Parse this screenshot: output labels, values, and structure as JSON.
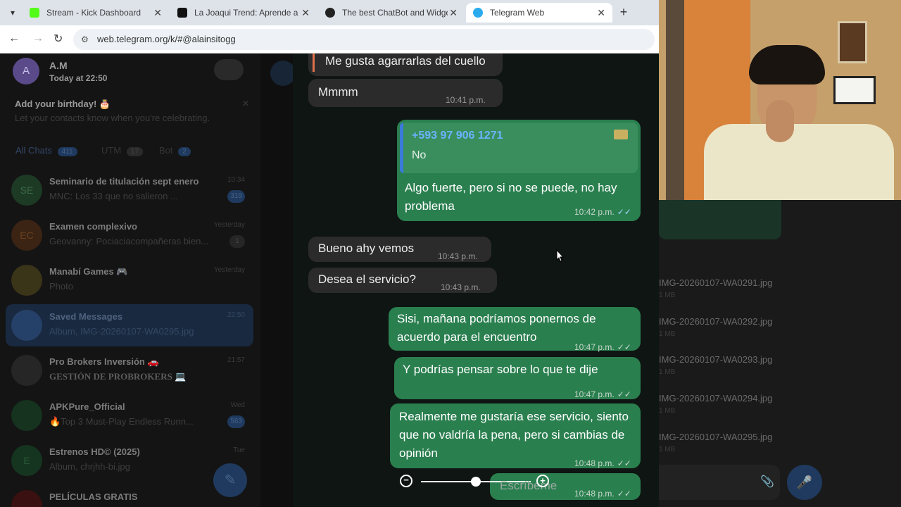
{
  "browser": {
    "tabs": [
      {
        "title": "Stream - Kick Dashboard",
        "favicon_color": "#53fc18"
      },
      {
        "title": "La Joaqui Trend: Aprende a Bail",
        "favicon_color": "#111111"
      },
      {
        "title": "The best ChatBot and Widgets",
        "favicon_color": "#222222"
      },
      {
        "title": "Telegram Web",
        "favicon_color": "#2aabee"
      }
    ],
    "url": "web.telegram.org/k/#@alainsitogg"
  },
  "sidebar": {
    "profile": {
      "initial": "A",
      "name": "A.M",
      "status": "Today at 22:50"
    },
    "birthday": {
      "title": "Add your birthday! 🎂",
      "text": "Let your contacts know when you're celebrating."
    },
    "filters": [
      {
        "label": "All Chats",
        "count": "411"
      },
      {
        "label": "UTM",
        "count": "17"
      },
      {
        "label": "Bot",
        "count": "2"
      }
    ],
    "chats": [
      {
        "name": "Seminario de titulación sept enero",
        "preview": "MNC: Los 33 que no salieron ... ",
        "time": "10:34",
        "badge": "319",
        "initials": "SE",
        "color": "#1d3a24"
      },
      {
        "name": "Examen complexivo",
        "preview": "Geovanny: Pociaciacompañeras bien...",
        "time": "Yesterday",
        "badge": "1",
        "initials": "EC",
        "color": "#3b2414"
      },
      {
        "name": "Manabí Games 🎮",
        "preview": "Photo",
        "time": "Yesterday",
        "badge": "",
        "initials": "",
        "color": "#3a3418"
      },
      {
        "name": "Saved Messages",
        "preview": "Album, IMG-20260107-WA0295.jpg",
        "time": "22:50",
        "badge": "",
        "initials": "",
        "color": "#1a2d48"
      },
      {
        "name": "Pro Brokers Inversión 🚗",
        "preview": "GESTIÓN DE PROBROKERS 💻",
        "time": "21:57",
        "badge": "",
        "initials": "",
        "color": "#262626"
      },
      {
        "name": "APKPure_Official",
        "preview": "🔥Top 3 Must-Play Endless Runn...",
        "time": "Wed",
        "badge": "563",
        "initials": "",
        "color": "#15331f"
      },
      {
        "name": "Estrenos HD© (2025)",
        "preview": "Album, chrjhh-bi.jpg",
        "time": "Tue",
        "badge": "",
        "initials": "E",
        "color": "#153520"
      },
      {
        "name": "PELÍCULAS GRATIS",
        "preview": "",
        "time": "",
        "badge": "",
        "initials": "",
        "color": "#3a1010"
      }
    ]
  },
  "chat": {
    "messages": [
      {
        "dir": "in",
        "text": "Me gusta agarrarlas del cuello",
        "time": ""
      },
      {
        "dir": "in",
        "text": "Mmmm",
        "time": "10:41 p.m."
      },
      {
        "dir": "out",
        "reply_phone": "+593 97 906 1271",
        "reply_text": "No",
        "text": "Algo fuerte, pero si no se puede, no hay problema",
        "time": "10:42 p.m."
      },
      {
        "dir": "in",
        "text": "Bueno ahy vemos",
        "time": "10:43 p.m."
      },
      {
        "dir": "in",
        "text": "Desea el servicio?",
        "time": "10:43 p.m."
      },
      {
        "dir": "out",
        "text": "Sisi, mañana podríamos ponernos de acuerdo para el encuentro",
        "time": "10:47 p.m."
      },
      {
        "dir": "out",
        "text": "Y podrías pensar sobre lo que te dije",
        "time": "10:47 p.m."
      },
      {
        "dir": "out",
        "text": "Realmente me gustaría ese servicio, siento que no valdría la pena, pero si cambias de opinión",
        "time": "10:48 p.m."
      },
      {
        "dir": "out",
        "text": "",
        "time": "10:48 p.m."
      }
    ],
    "input_placeholder": "Escríbeme",
    "zoom_level": 0.5
  },
  "shared_files": [
    {
      "name": "IMG-20260107-WA0291.jpg",
      "size": "1 MB"
    },
    {
      "name": "IMG-20260107-WA0292.jpg",
      "size": "1 MB"
    },
    {
      "name": "IMG-20260107-WA0293.jpg",
      "size": "1 MB"
    },
    {
      "name": "IMG-20260107-WA0294.jpg",
      "size": "1 MB"
    },
    {
      "name": "IMG-20260107-WA0295.jpg",
      "size": "1 MB"
    }
  ],
  "colors": {
    "accent": "#2aabee",
    "outgoing": "#2a7f4f",
    "incoming": "#2b2b2b"
  }
}
